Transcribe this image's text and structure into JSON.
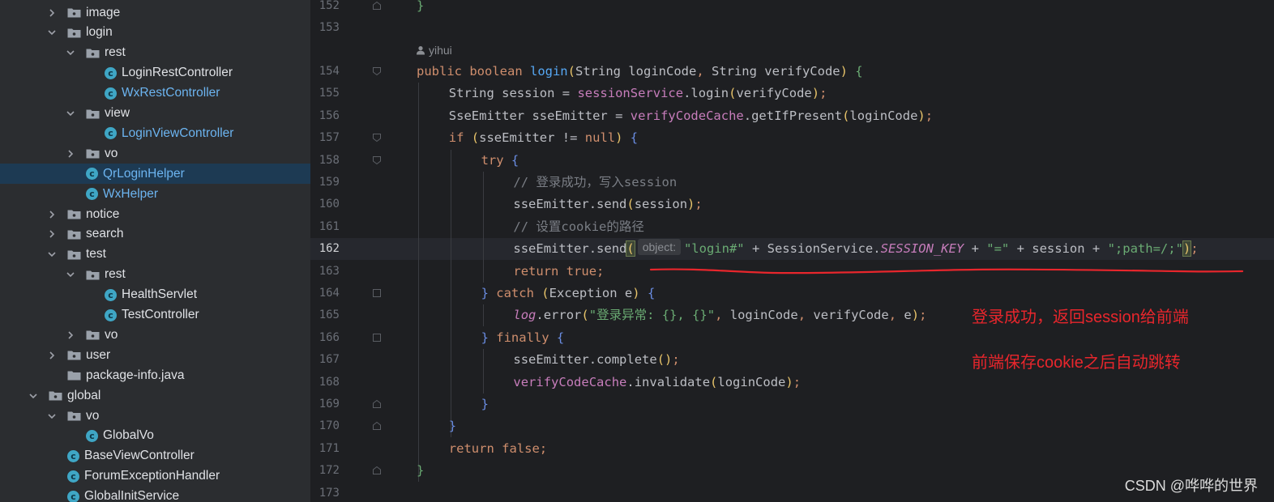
{
  "colors": {
    "tree_bg": "#2b2d30",
    "editor_bg": "#1e1f22",
    "selection": "#1d3a53",
    "keyword": "#cf8e6d",
    "function": "#56a8f5",
    "field": "#c77dbb",
    "string": "#6aab73",
    "comment": "#7a7e85",
    "annotation_red": "#e8262c"
  },
  "tree": {
    "items": [
      {
        "label": "image",
        "type": "folder",
        "expanded": false,
        "depth": 1,
        "style": "normal",
        "selected": false
      },
      {
        "label": "login",
        "type": "folder",
        "expanded": true,
        "depth": 1,
        "style": "normal",
        "selected": false
      },
      {
        "label": "rest",
        "type": "folder",
        "expanded": true,
        "depth": 2,
        "style": "normal",
        "selected": false
      },
      {
        "label": "LoginRestController",
        "type": "class",
        "depth": 3,
        "style": "normal",
        "selected": false
      },
      {
        "label": "WxRestController",
        "type": "class",
        "depth": 3,
        "style": "blue",
        "selected": false
      },
      {
        "label": "view",
        "type": "folder",
        "expanded": true,
        "depth": 2,
        "style": "normal",
        "selected": false
      },
      {
        "label": "LoginViewController",
        "type": "class",
        "depth": 3,
        "style": "blue",
        "selected": false
      },
      {
        "label": "vo",
        "type": "folder",
        "expanded": false,
        "depth": 2,
        "style": "normal",
        "selected": false
      },
      {
        "label": "QrLoginHelper",
        "type": "class",
        "depth": 2,
        "style": "blue",
        "selected": true
      },
      {
        "label": "WxHelper",
        "type": "class",
        "depth": 2,
        "style": "blue",
        "selected": false
      },
      {
        "label": "notice",
        "type": "folder",
        "expanded": false,
        "depth": 1,
        "style": "normal",
        "selected": false
      },
      {
        "label": "search",
        "type": "folder",
        "expanded": false,
        "depth": 1,
        "style": "normal",
        "selected": false
      },
      {
        "label": "test",
        "type": "folder",
        "expanded": true,
        "depth": 1,
        "style": "normal",
        "selected": false
      },
      {
        "label": "rest",
        "type": "folder",
        "expanded": true,
        "depth": 2,
        "style": "normal",
        "selected": false
      },
      {
        "label": "HealthServlet",
        "type": "class",
        "depth": 3,
        "style": "normal",
        "selected": false
      },
      {
        "label": "TestController",
        "type": "class",
        "depth": 3,
        "style": "normal",
        "selected": false
      },
      {
        "label": "vo",
        "type": "folder",
        "expanded": false,
        "depth": 2,
        "style": "normal",
        "selected": false
      },
      {
        "label": "user",
        "type": "folder",
        "expanded": false,
        "depth": 1,
        "style": "normal",
        "selected": false
      },
      {
        "label": "package-info.java",
        "type": "file",
        "depth": 1,
        "style": "normal",
        "selected": false
      },
      {
        "label": "global",
        "type": "folder",
        "expanded": true,
        "depth": 0,
        "style": "normal",
        "selected": false
      },
      {
        "label": "vo",
        "type": "folder",
        "expanded": true,
        "depth": 1,
        "style": "normal",
        "selected": false
      },
      {
        "label": "GlobalVo",
        "type": "class",
        "depth": 2,
        "style": "normal",
        "selected": false
      },
      {
        "label": "BaseViewController",
        "type": "class",
        "depth": 1,
        "style": "normal",
        "selected": false
      },
      {
        "label": "ForumExceptionHandler",
        "type": "class",
        "depth": 1,
        "style": "normal",
        "selected": false
      },
      {
        "label": "GlobalInitService",
        "type": "class",
        "depth": 1,
        "style": "normal",
        "selected": false
      }
    ]
  },
  "editor": {
    "author": "yihui",
    "active_line": "162",
    "lines": [
      {
        "num": "152",
        "indent": 0,
        "tokens": [
          [
            "}",
            "brace-g"
          ]
        ]
      },
      {
        "num": "153",
        "indent": 0,
        "tokens": []
      },
      {
        "num": "154",
        "indent": 0,
        "tokens": [
          [
            "public ",
            "kw"
          ],
          [
            "boolean ",
            "kw"
          ],
          [
            "login",
            "fn"
          ],
          [
            "(",
            "brace-y"
          ],
          [
            "String loginCode",
            ""
          ],
          [
            ", ",
            "kw"
          ],
          [
            "String verifyCode",
            ""
          ],
          [
            ") ",
            "brace-y"
          ],
          [
            "{",
            "brace-g"
          ]
        ]
      },
      {
        "num": "155",
        "indent": 1,
        "tokens": [
          [
            "String session = ",
            ""
          ],
          [
            "sessionService",
            "fld"
          ],
          [
            ".login",
            ""
          ],
          [
            "(",
            "brace-y"
          ],
          [
            "verifyCode",
            ""
          ],
          [
            ")",
            "brace-y"
          ],
          [
            ";",
            "kw"
          ]
        ]
      },
      {
        "num": "156",
        "indent": 1,
        "tokens": [
          [
            "SseEmitter sseEmitter = ",
            ""
          ],
          [
            "verifyCodeCache",
            "fld"
          ],
          [
            ".getIfPresent",
            ""
          ],
          [
            "(",
            "brace-y"
          ],
          [
            "loginCode",
            ""
          ],
          [
            ")",
            "brace-y"
          ],
          [
            ";",
            "kw"
          ]
        ]
      },
      {
        "num": "157",
        "indent": 1,
        "tokens": [
          [
            "if ",
            "kw"
          ],
          [
            "(",
            "brace-y"
          ],
          [
            "sseEmitter != ",
            ""
          ],
          [
            "null",
            "kw"
          ],
          [
            ") ",
            "brace-y"
          ],
          [
            "{",
            "brace-b"
          ]
        ]
      },
      {
        "num": "158",
        "indent": 2,
        "tokens": [
          [
            "try ",
            "kw"
          ],
          [
            "{",
            "brace-b"
          ]
        ]
      },
      {
        "num": "159",
        "indent": 3,
        "tokens": [
          [
            "// 登录成功，写入session",
            "cmt"
          ]
        ]
      },
      {
        "num": "160",
        "indent": 3,
        "tokens": [
          [
            "sseEmitter.send",
            ""
          ],
          [
            "(",
            "brace-y"
          ],
          [
            "session",
            ""
          ],
          [
            ")",
            "brace-y"
          ],
          [
            ";",
            "kw"
          ]
        ]
      },
      {
        "num": "161",
        "indent": 3,
        "tokens": [
          [
            "// 设置cookie的路径",
            "cmt"
          ]
        ]
      },
      {
        "num": "162",
        "indent": 3,
        "tokens": [
          [
            "sseEmitter.send",
            ""
          ],
          [
            "(",
            "caret"
          ],
          [
            "object:",
            "hint"
          ],
          [
            "\"login#\"",
            "str"
          ],
          [
            " + SessionService.",
            ""
          ],
          [
            "SESSION_KEY",
            "static"
          ],
          [
            " + ",
            ""
          ],
          [
            "\"=\"",
            "str"
          ],
          [
            " + session + ",
            ""
          ],
          [
            "\";path=/;\"",
            "str"
          ],
          [
            ")",
            "caret"
          ],
          [
            ";",
            "kw"
          ]
        ]
      },
      {
        "num": "163",
        "indent": 3,
        "tokens": [
          [
            "return ",
            "kw"
          ],
          [
            "true",
            "kw"
          ],
          [
            ";",
            "kw"
          ]
        ]
      },
      {
        "num": "164",
        "indent": 2,
        "tokens": [
          [
            "} ",
            "brace-b"
          ],
          [
            "catch ",
            "kw"
          ],
          [
            "(",
            "brace-y"
          ],
          [
            "Exception e",
            ""
          ],
          [
            ") ",
            "brace-y"
          ],
          [
            "{",
            "brace-b"
          ]
        ]
      },
      {
        "num": "165",
        "indent": 3,
        "tokens": [
          [
            "log",
            "static"
          ],
          [
            ".error",
            ""
          ],
          [
            "(",
            "brace-y"
          ],
          [
            "\"登录异常: {}, {}\"",
            "str"
          ],
          [
            ", ",
            "kw"
          ],
          [
            "loginCode",
            ""
          ],
          [
            ", ",
            "kw"
          ],
          [
            "verifyCode",
            ""
          ],
          [
            ", ",
            "kw"
          ],
          [
            "e",
            ""
          ],
          [
            ")",
            "brace-y"
          ],
          [
            ";",
            "kw"
          ]
        ]
      },
      {
        "num": "166",
        "indent": 2,
        "tokens": [
          [
            "} ",
            "brace-b"
          ],
          [
            "finally ",
            "kw"
          ],
          [
            "{",
            "brace-b"
          ]
        ]
      },
      {
        "num": "167",
        "indent": 3,
        "tokens": [
          [
            "sseEmitter.complete",
            ""
          ],
          [
            "()",
            "brace-y"
          ],
          [
            ";",
            "kw"
          ]
        ]
      },
      {
        "num": "168",
        "indent": 3,
        "tokens": [
          [
            "verifyCodeCache",
            "fld"
          ],
          [
            ".invalidate",
            ""
          ],
          [
            "(",
            "brace-y"
          ],
          [
            "loginCode",
            ""
          ],
          [
            ")",
            "brace-y"
          ],
          [
            ";",
            "kw"
          ]
        ]
      },
      {
        "num": "169",
        "indent": 2,
        "tokens": [
          [
            "}",
            "brace-b"
          ]
        ]
      },
      {
        "num": "170",
        "indent": 1,
        "tokens": [
          [
            "}",
            "brace-b"
          ]
        ]
      },
      {
        "num": "171",
        "indent": 1,
        "tokens": [
          [
            "return ",
            "kw"
          ],
          [
            "false",
            "kw"
          ],
          [
            ";",
            "kw"
          ]
        ]
      },
      {
        "num": "172",
        "indent": 0,
        "tokens": [
          [
            "}",
            "brace-g"
          ]
        ]
      },
      {
        "num": "173",
        "indent": 0,
        "tokens": []
      }
    ]
  },
  "annotations": {
    "line1": "登录成功，返回session给前端",
    "line2": "前端保存cookie之后自动跳转"
  },
  "watermark": "CSDN @哗哗的世界"
}
